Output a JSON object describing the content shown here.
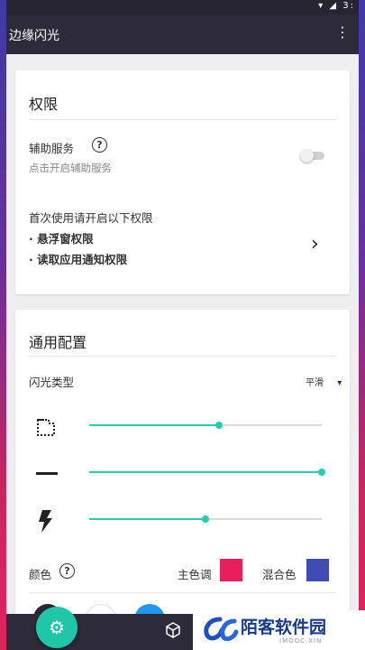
{
  "app": {
    "title": "边缘闪光",
    "menu_icon": "more-vert-icon"
  },
  "status": {
    "icons": "▾ ◢ 3:"
  },
  "permissions": {
    "heading": "权限",
    "accessibility_label": "辅助服务",
    "accessibility_hint": "点击开启辅助服务",
    "accessibility_enabled": false,
    "first_use_text": "首次使用请开启以下权限",
    "items": [
      "· 悬浮窗权限",
      "· 读取应用通知权限"
    ]
  },
  "general": {
    "heading": "通用配置",
    "flash_type_label": "闪光类型",
    "flash_type_value": "平滑",
    "sliders": [
      {
        "icon": "corner-dashed-icon",
        "value": 0.56
      },
      {
        "icon": "line-width-icon",
        "value": 1.0
      },
      {
        "icon": "flash-icon",
        "value": 0.5
      }
    ],
    "color_label": "颜色",
    "main_tone_label": "主色调",
    "main_tone_color": "#e91e5a",
    "mix_color_label": "混合色",
    "mix_color": "#3f4db3"
  },
  "palette": [
    "#2a2838",
    "#ffffff",
    "#2196f3"
  ],
  "colors": {
    "accent": "#25cdb0",
    "appbar": "#2d2b39"
  },
  "watermark": {
    "text": "陌客软件园",
    "url": "IMOOC.XIN"
  }
}
